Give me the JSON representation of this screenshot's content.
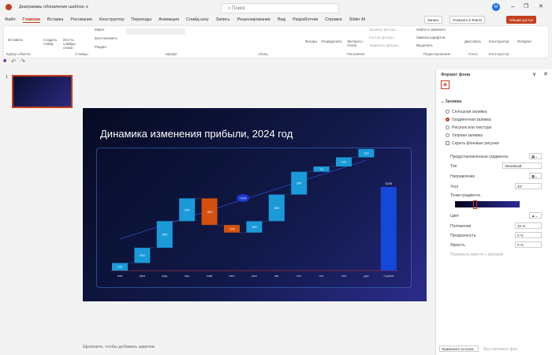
{
  "title_bar": {
    "doc_name": "Диаграммы обновление шаблон ∨",
    "search_placeholder": "Поиск",
    "avatar": "M"
  },
  "tabs": [
    "Файл",
    "Главная",
    "Вставка",
    "Рисование",
    "Конструктор",
    "Переходы",
    "Анимация",
    "Слайд-шоу",
    "Запись",
    "Рецензирование",
    "Вид",
    "Разработчик",
    "Справка",
    "Slider AI"
  ],
  "active_tab": 1,
  "right_buttons": {
    "record": "Запись",
    "present": "Показать в Teams",
    "share": "Общий доступ"
  },
  "ribbon_groups": [
    {
      "label": "Буфер обмена",
      "items": [
        "Вставить"
      ]
    },
    {
      "label": "Слайды",
      "items": [
        "Создать слайд",
        "Исп-ть слайды снова",
        "Макет",
        "Восстановить",
        "Раздел"
      ]
    },
    {
      "label": "Шрифт",
      "items": []
    },
    {
      "label": "Абзац",
      "items": []
    },
    {
      "label": "Рисование",
      "items": [
        "Фигуры",
        "Упорядочить",
        "Экспресс-стили",
        "Заливка фигуры",
        "Контур фигуры",
        "Эффекты фигуры"
      ]
    },
    {
      "label": "Редактирование",
      "items": [
        "Найти и заменить",
        "Замена шрифтов",
        "Выделить"
      ]
    },
    {
      "label": "Голос",
      "items": [
        "Диктовать"
      ]
    },
    {
      "label": "Конструктор",
      "items": [
        "Конструктор"
      ]
    },
    {
      "label": "",
      "items": [
        "Designer"
      ]
    }
  ],
  "thumbnail": {
    "number": "1"
  },
  "slide": {
    "title": "Динамика изменения прибыли, 2024 год",
    "badge": "+10%"
  },
  "chart_data": {
    "type": "waterfall",
    "categories": [
      "янв",
      "фев",
      "мар",
      "апр",
      "май",
      "июн",
      "июл",
      "авг",
      "сен",
      "окт",
      "ноя",
      "дек",
      "Сумма"
    ],
    "values": [
      100,
      200,
      350,
      300,
      -350,
      -100,
      150,
      350,
      300,
      70,
      120,
      110
    ],
    "total": 1100,
    "colors": {
      "increase": "#1a9ad8",
      "decrease": "#d4500f",
      "total": "#1448d8"
    }
  },
  "format_pane": {
    "title": "Формат фона",
    "section": "Заливка",
    "fill_options": [
      "Сплошная заливка",
      "Градиентная заливка",
      "Рисунок или текстура",
      "Узорная заливка"
    ],
    "selected_fill": 1,
    "hide_bg": "Скрыть фоновые рисунки",
    "preset": "Предустановленные градиенты",
    "type_label": "Тип",
    "type_value": "Линейный",
    "direction": "Направление",
    "angle_label": "Угол",
    "angle_value": "45°",
    "stops": "Точки градиента",
    "color": "Цвет",
    "position_label": "Положение",
    "position_value": "32 %",
    "transparency_label": "Прозрачность",
    "transparency_value": "0 %",
    "brightness_label": "Яркость",
    "brightness_value": "0 %",
    "rotate": "Повернуть вместе с фигурой",
    "apply_all": "Применить ко всем",
    "reset": "Восстановить фон"
  },
  "notes_placeholder": "Щелкните, чтобы добавить заметки"
}
